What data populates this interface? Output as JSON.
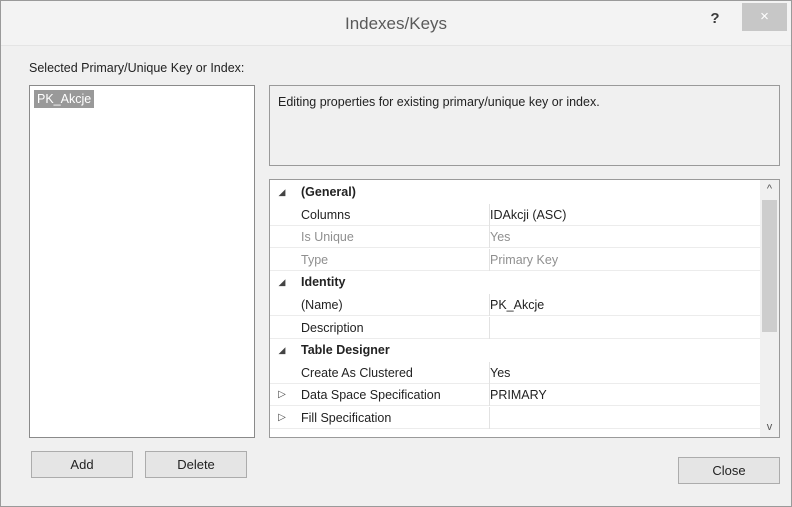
{
  "window": {
    "title": "Indexes/Keys",
    "help_label": "?",
    "close_label": "×"
  },
  "selected_label": "Selected Primary/Unique Key or Index:",
  "key_list": {
    "items": [
      {
        "label": "PK_Akcje",
        "selected": true
      }
    ]
  },
  "description": "Editing properties for existing primary/unique key or index.",
  "property_grid": {
    "rows": [
      {
        "kind": "category",
        "expander": "◢",
        "name": "(General)",
        "value": ""
      },
      {
        "kind": "property",
        "expander": "",
        "name": "Columns",
        "value": "IDAkcji (ASC)"
      },
      {
        "kind": "property-disabled",
        "expander": "",
        "name": "Is Unique",
        "value": "Yes"
      },
      {
        "kind": "property-disabled",
        "expander": "",
        "name": "Type",
        "value": "Primary Key"
      },
      {
        "kind": "category",
        "expander": "◢",
        "name": "Identity",
        "value": ""
      },
      {
        "kind": "property",
        "expander": "",
        "name": "(Name)",
        "value": "PK_Akcje"
      },
      {
        "kind": "property",
        "expander": "",
        "name": "Description",
        "value": ""
      },
      {
        "kind": "category",
        "expander": "◢",
        "name": "Table Designer",
        "value": ""
      },
      {
        "kind": "property",
        "expander": "",
        "name": "Create As Clustered",
        "value": "Yes"
      },
      {
        "kind": "property",
        "expander": "▷",
        "name": "Data Space Specification",
        "value": "PRIMARY"
      },
      {
        "kind": "property",
        "expander": "▷",
        "name": "Fill Specification",
        "value": ""
      }
    ],
    "scroll_up": "^",
    "scroll_down": "v"
  },
  "buttons": {
    "add": "Add",
    "delete": "Delete",
    "close": "Close"
  },
  "colors": {
    "selection": "#999999",
    "dialog_bg": "#f0f0f0",
    "title_close_bg": "#c7c7c7"
  }
}
